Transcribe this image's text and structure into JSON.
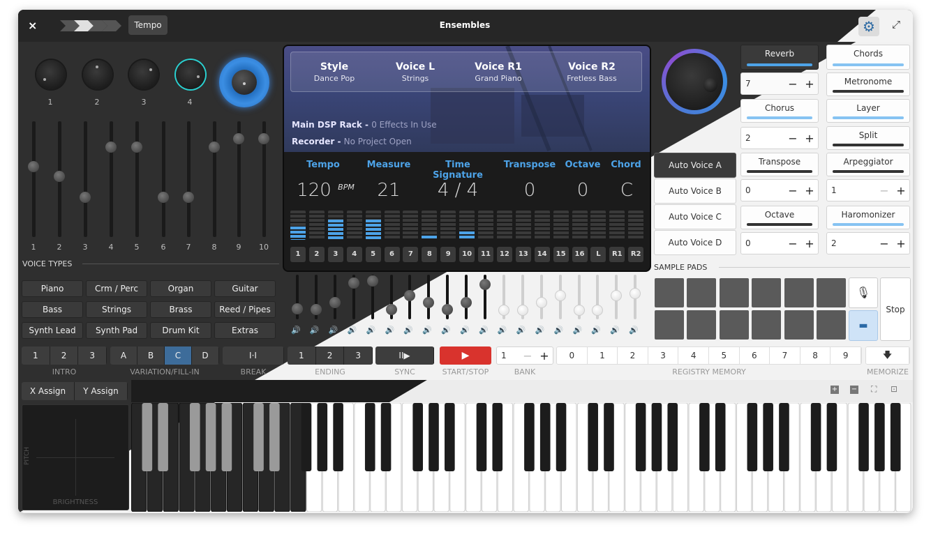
{
  "window": {
    "title": "Ensembles",
    "tempo_button": "Tempo",
    "close_icon": "×"
  },
  "colors": {
    "accent": "#4da3e8",
    "record": "#d9332d",
    "screen_top": "#3a4578",
    "screen_bottom": "#1b1b1b",
    "highlight": "#3d6c9a"
  },
  "knobs": {
    "labels": [
      "1",
      "2",
      "3",
      "4"
    ]
  },
  "sliders": {
    "labels": [
      "1",
      "2",
      "3",
      "4",
      "5",
      "6",
      "7",
      "8",
      "9",
      "10"
    ],
    "levels": [
      0.62,
      0.53,
      0.33,
      0.81,
      0.81,
      0.33,
      0.33,
      0.81,
      0.89,
      0.89
    ]
  },
  "voice_types": {
    "heading": "VOICE TYPES",
    "buttons": [
      "Piano",
      "Crm / Perc",
      "Organ",
      "Guitar",
      "Bass",
      "Strings",
      "Brass",
      "Reed / Pipes",
      "Synth Lead",
      "Synth Pad",
      "Drum Kit",
      "Extras"
    ]
  },
  "screen": {
    "header": [
      {
        "title": "Style",
        "value": "Dance Pop"
      },
      {
        "title": "Voice L",
        "value": "Strings"
      },
      {
        "title": "Voice R1",
        "value": "Grand Piano"
      },
      {
        "title": "Voice R2",
        "value": "Fretless Bass"
      }
    ],
    "dsp_label": "Main DSP Rack - ",
    "dsp_value": "0 Effects In Use",
    "rec_label": "Recorder - ",
    "rec_value": "No Project Open",
    "params": [
      "Tempo",
      "Measure",
      "Time Signature",
      "Transpose",
      "Octave",
      "Chord"
    ],
    "tempo": "120",
    "bpm": "BPM",
    "measure": "21",
    "time_signature": "4 / 4",
    "transpose": "0",
    "octave": "0",
    "chord": "C",
    "channels": [
      "1",
      "2",
      "3",
      "4",
      "5",
      "6",
      "7",
      "8",
      "9",
      "10",
      "11",
      "12",
      "13",
      "14",
      "15",
      "16",
      "L",
      "R1",
      "R2"
    ],
    "channel_levels": [
      0.45,
      0,
      0.7,
      0,
      0.7,
      0,
      0,
      0.15,
      0,
      0.28,
      0,
      0,
      0,
      0,
      0,
      0,
      0,
      0,
      0
    ]
  },
  "mixer": {
    "levels": [
      0.25,
      0.22,
      0.4,
      0.93,
      0.98,
      0.22,
      0.6,
      0.4,
      0.22,
      0.4,
      0.88,
      0.2,
      0.2,
      0.4,
      0.6,
      0.2,
      0.2,
      0.6,
      0.65
    ]
  },
  "side": {
    "reverb": "Reverb",
    "chords": "Chords",
    "metronome": "Metronome",
    "chorus": "Chorus",
    "layer": "Layer",
    "split": "Split",
    "transpose": "Transpose",
    "arpeggiator": "Arpeggiator",
    "octave": "Octave",
    "harmonizer": "Haromonizer",
    "reverb_val": "7",
    "chorus_val": "2",
    "transpose_val": "0",
    "arp_val": "1",
    "octave_val": "0",
    "harm_val": "2",
    "minus": "−",
    "plus": "+",
    "auto_voices": [
      "Auto Voice A",
      "Auto Voice B",
      "Auto Voice C",
      "Auto Voice D"
    ]
  },
  "sample_pads": {
    "heading": "SAMPLE PADS",
    "stop": "Stop",
    "mic_icon": "microphone-icon",
    "folder_icon": "folder-icon"
  },
  "controls": {
    "intro": [
      "1",
      "2",
      "3"
    ],
    "intro_label": "INTRO",
    "variation": [
      "A",
      "B",
      "C",
      "D"
    ],
    "variation_label": "VARIATION/FILL-IN",
    "variation_selected": "C",
    "break_label": "BREAK",
    "break_icon": "I·I",
    "ending": [
      "1",
      "2",
      "3"
    ],
    "ending_label": "ENDING",
    "sync_label": "SYNC",
    "sync_icon": "II▶",
    "start_label": "START/STOP",
    "start_icon": "▶",
    "bank_value": "1",
    "bank_label": "BANK",
    "registry": [
      "0",
      "1",
      "2",
      "3",
      "4",
      "5",
      "6",
      "7",
      "8",
      "9"
    ],
    "registry_label": "REGISTRY MEMORY",
    "memorize_label": "MEMORIZE",
    "memorize_icon": "🡇"
  },
  "assign": {
    "x": "X Assign",
    "y": "Y Assign",
    "pitch": "PITCH",
    "brightness": "BRIGHTNESS"
  }
}
